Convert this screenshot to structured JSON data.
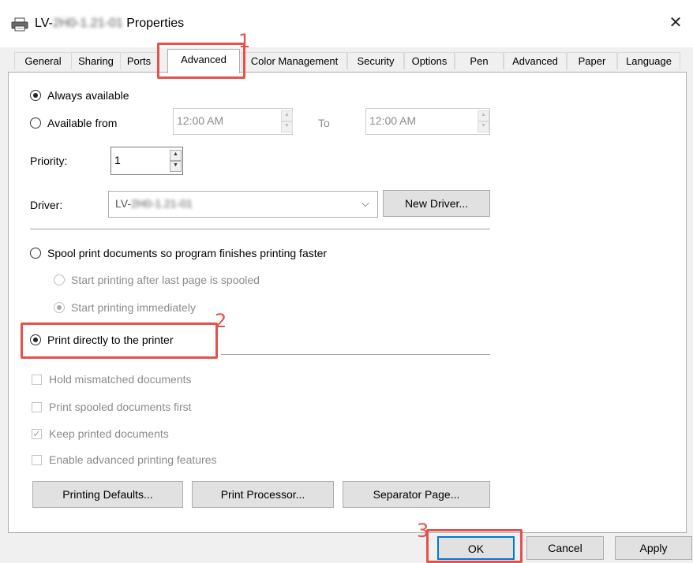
{
  "window": {
    "title_prefix": "LV-",
    "title_blurred": "2H0-1.21-01",
    "title_suffix": " Properties",
    "close_glyph": "✕"
  },
  "tabs": [
    {
      "label": "General"
    },
    {
      "label": "Sharing"
    },
    {
      "label": "Ports"
    },
    {
      "label": "Advanced",
      "active": true
    },
    {
      "label": "Color Management"
    },
    {
      "label": "Security"
    },
    {
      "label": "Options"
    },
    {
      "label": "Pen"
    },
    {
      "label": "Advanced"
    },
    {
      "label": "Paper"
    },
    {
      "label": "Language"
    }
  ],
  "availability": {
    "always_label": "Always available",
    "from_label": "Available from",
    "from_time": "12:00 AM",
    "to_label": "To",
    "to_time": "12:00 AM",
    "selected": "always"
  },
  "priority": {
    "label": "Priority:",
    "value": "1"
  },
  "driver": {
    "label": "Driver:",
    "value_prefix": "LV-",
    "value_blurred": "2H0-1.21-01",
    "new_driver_label": "New Driver..."
  },
  "spooling": {
    "spool_label": "Spool print documents so program finishes printing faster",
    "after_last_label": "Start printing after last page is spooled",
    "immediately_label": "Start printing immediately",
    "direct_label": "Print directly to the printer",
    "selected": "direct"
  },
  "options": {
    "hold_mismatched": {
      "label": "Hold mismatched documents",
      "checked": false
    },
    "spooled_first": {
      "label": "Print spooled documents first",
      "checked": false
    },
    "keep_printed": {
      "label": "Keep printed documents",
      "checked": true
    },
    "advanced_features": {
      "label": "Enable advanced printing features",
      "checked": false
    }
  },
  "bottom_buttons": {
    "printing_defaults": "Printing Defaults...",
    "print_processor": "Print Processor...",
    "separator_page": "Separator Page..."
  },
  "dialog_buttons": {
    "ok": "OK",
    "cancel": "Cancel",
    "apply": "Apply"
  },
  "annotations": {
    "step1": "1",
    "step2": "2",
    "step3": "3",
    "color": "#e2534c"
  }
}
